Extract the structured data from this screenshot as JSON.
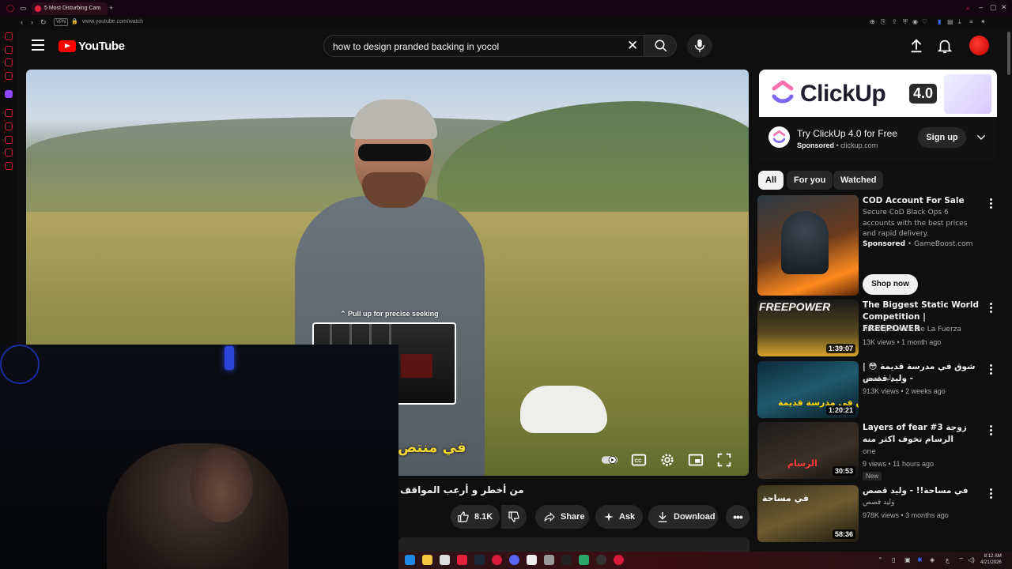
{
  "browser": {
    "tab_title": "5 Most Disturbing Cam",
    "url": "www.youtube.com/watch",
    "time": "8:12 AM",
    "date": "4/21/2026"
  },
  "header": {
    "logo_text": "YouTube",
    "search_value": "how to design pranded backing in yocol"
  },
  "video": {
    "seek_hint": "⌃ Pull up for precise seeking",
    "caption_overlay": "في منتص",
    "title": "من أخطر و أرعب المواقف"
  },
  "actions": {
    "likes": "8.1K",
    "share": "Share",
    "ask": "Ask",
    "download": "Download"
  },
  "ad": {
    "brand": "ClickUp",
    "version": "4.0",
    "title": "Try ClickUp 4.0 for Free",
    "sponsored": "Sponsored",
    "domain": "clickup.com",
    "signup": "Sign up"
  },
  "chips": [
    "All",
    "For you",
    "Watched"
  ],
  "recommendations": [
    {
      "title": "COD Account For Sale",
      "desc": "Secure CoD Black Ops 6 accounts with the best prices and rapid delivery.",
      "sponsored": "Sponsored",
      "channel": "GameBoost.com",
      "cta": "Shop now"
    },
    {
      "title": "The Biggest Static World Competition | FREEPOWER",
      "channel": "ARZA | El Arte De La Fuerza",
      "meta": "13K views • 1 month ago",
      "duration": "1:39:07",
      "thumb_text": "FREEPOWER"
    },
    {
      "title": "شوق في مدرسة قديمة 😳 | - وليد قصص",
      "channel": "وليد قصص",
      "meta": "913K views • 2 weeks ago",
      "duration": "1:20:21",
      "thumb_text": "شوق في مدرسة قديمة"
    },
    {
      "title": "Layers of fear #3 زوجة الرسام تخوف اكثر منه",
      "channel": "one",
      "meta": "9 views • 11 hours ago",
      "duration": "30:53",
      "badge": "New",
      "thumb_text": "الرسام"
    },
    {
      "title": "في مساحة!! - وليد قصص",
      "channel": "وليد قصص",
      "meta": "978K views • 3 months ago",
      "duration": "58:36",
      "thumb_text": "في مساحة"
    }
  ],
  "colors": {
    "yt_red": "#ff0000",
    "background": "#0f0f0f",
    "chip": "#272727"
  }
}
